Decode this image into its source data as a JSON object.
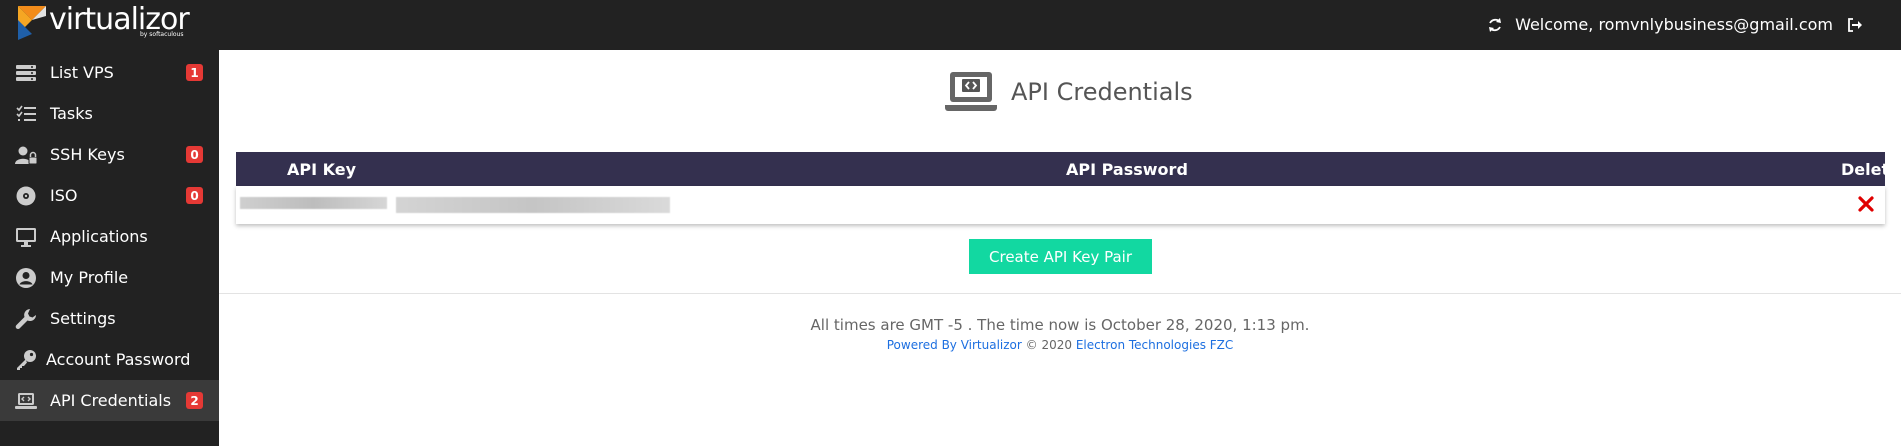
{
  "brand": {
    "name": "virtualizor",
    "tagline": "by softaculous"
  },
  "header": {
    "welcome": "Welcome, romvnlybusiness@gmail.com"
  },
  "sidebar": {
    "items": [
      {
        "label": "List VPS",
        "icon": "server-list-icon",
        "badge": "1"
      },
      {
        "label": "Tasks",
        "icon": "task-list-icon",
        "badge": ""
      },
      {
        "label": "SSH Keys",
        "icon": "user-lock-icon",
        "badge": "0"
      },
      {
        "label": "ISO",
        "icon": "disc-icon",
        "badge": "0"
      },
      {
        "label": "Applications",
        "icon": "monitor-icon",
        "badge": ""
      },
      {
        "label": "My Profile",
        "icon": "user-circle-icon",
        "badge": ""
      },
      {
        "label": "Settings",
        "icon": "wrench-icon",
        "badge": ""
      },
      {
        "label": "Account Password",
        "icon": "key-icon",
        "badge": ""
      },
      {
        "label": "API Credentials",
        "icon": "laptop-code-icon",
        "badge": "2"
      }
    ]
  },
  "page": {
    "title": "API Credentials"
  },
  "table": {
    "headers": {
      "api_key": "API Key",
      "api_password": "API Password",
      "delete": "Delete"
    }
  },
  "actions": {
    "create_label": "Create API Key Pair"
  },
  "footer": {
    "time_text": "All times are GMT -5 . The time now is October 28, 2020, 1:13 pm.",
    "powered_by": "Powered By Virtualizor",
    "copyright": " © 2020 ",
    "company": "Electron Technologies FZC"
  },
  "colors": {
    "topbar": "#222222",
    "sidebar": "#222222",
    "table_header": "#34304f",
    "create_button": "#12d8a1",
    "badge": "#e53935",
    "delete_icon": "#e00000",
    "link": "#1d6fe0"
  }
}
